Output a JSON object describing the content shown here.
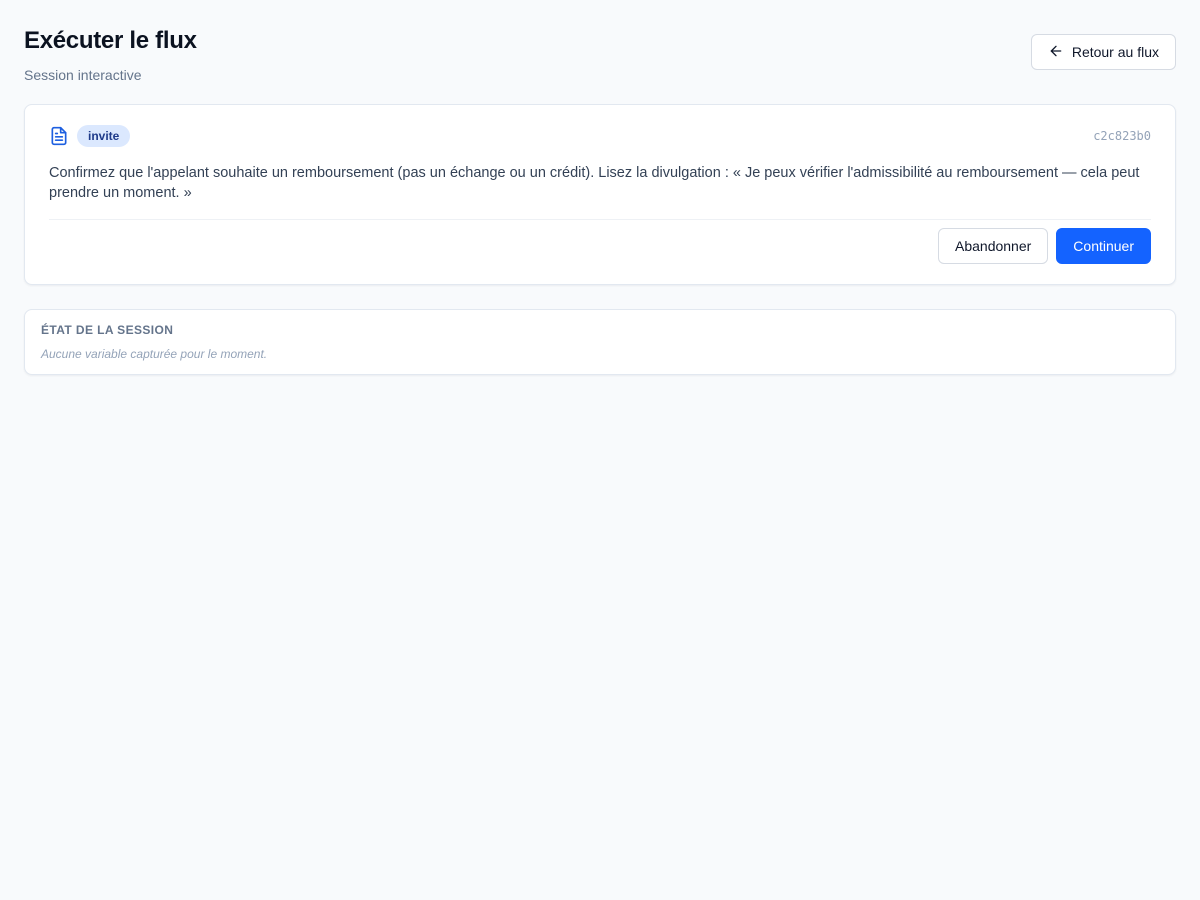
{
  "header": {
    "title": "Exécuter le flux",
    "subtitle": "Session interactive",
    "back_label": "Retour au flux"
  },
  "step": {
    "icon": "document-icon",
    "badge": "invite",
    "node_id": "c2c823b0",
    "text": "Confirmez que l'appelant souhaite un remboursement (pas un échange ou un crédit). Lisez la divulgation : « Je peux vérifier l'admissibilité au remboursement — cela peut prendre un moment. »",
    "abandon_label": "Abandonner",
    "continue_label": "Continuer"
  },
  "session_state": {
    "title": "ÉTAT DE LA SESSION",
    "empty_text": "Aucune variable capturée pour le moment."
  },
  "colors": {
    "primary": "#1463ff",
    "badge_bg": "#dbe8fe",
    "badge_text": "#1e3a8a",
    "background": "#f8fafc"
  }
}
